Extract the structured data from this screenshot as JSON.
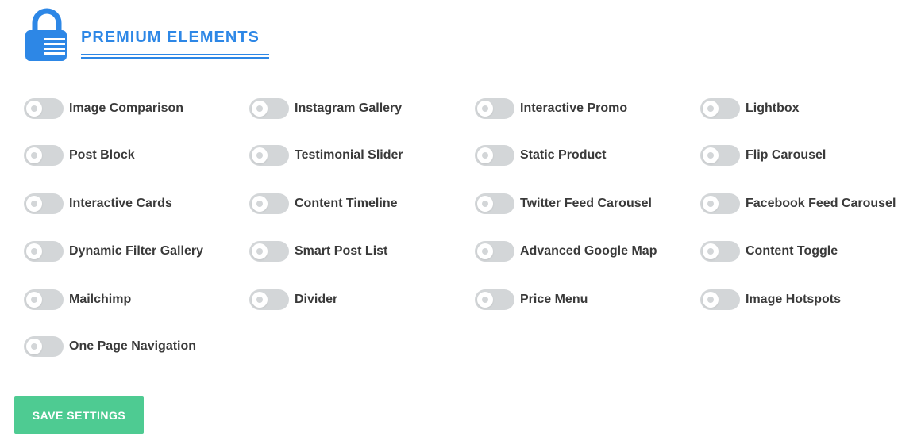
{
  "header": {
    "title": "PREMIUM ELEMENTS",
    "icon": "lock-icon",
    "accent_color": "#2d87e6"
  },
  "elements": {
    "items": [
      {
        "label": "Image Comparison",
        "enabled": false
      },
      {
        "label": "Instagram Gallery",
        "enabled": false
      },
      {
        "label": "Interactive Promo",
        "enabled": false
      },
      {
        "label": "Lightbox",
        "enabled": false
      },
      {
        "label": "Post Block",
        "enabled": false
      },
      {
        "label": "Testimonial Slider",
        "enabled": false
      },
      {
        "label": "Static Product",
        "enabled": false
      },
      {
        "label": "Flip Carousel",
        "enabled": false
      },
      {
        "label": "Interactive Cards",
        "enabled": false
      },
      {
        "label": "Content Timeline",
        "enabled": false
      },
      {
        "label": "Twitter Feed Carousel",
        "enabled": false
      },
      {
        "label": "Facebook Feed Carousel",
        "enabled": false
      },
      {
        "label": "Dynamic Filter Gallery",
        "enabled": false
      },
      {
        "label": "Smart Post List",
        "enabled": false
      },
      {
        "label": "Advanced Google Map",
        "enabled": false
      },
      {
        "label": "Content Toggle",
        "enabled": false
      },
      {
        "label": "Mailchimp",
        "enabled": false
      },
      {
        "label": "Divider",
        "enabled": false
      },
      {
        "label": "Price Menu",
        "enabled": false
      },
      {
        "label": "Image Hotspots",
        "enabled": false
      },
      {
        "label": "One Page Navigation",
        "enabled": false
      }
    ]
  },
  "save_button": {
    "label": "SAVE SETTINGS",
    "color": "#4ecb92"
  },
  "colors": {
    "toggle_off": "#d3d6d8",
    "label_text": "#3a3a3a"
  }
}
